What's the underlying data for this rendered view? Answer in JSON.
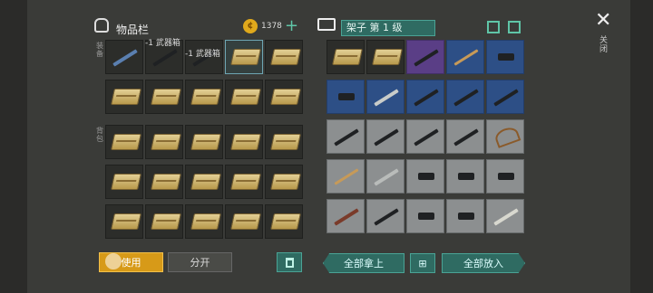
{
  "inventory": {
    "title": "物品栏",
    "coins": "1378",
    "side_top_label": "装备",
    "side_mid_label": "背包",
    "weapon_box_label_1": "-1 武器箱",
    "weapon_box_label_2": "-1 武器箱"
  },
  "shelf": {
    "title": "架子 第 1 级"
  },
  "close": {
    "label": "关闭"
  },
  "buttons": {
    "use": "使用",
    "split": "分开",
    "take_all": "全部拿上",
    "put_all": "全部放入"
  },
  "colors": {
    "accent": "#2f6b62",
    "use": "#d79a18",
    "rare_blue": "#2d4f86",
    "rare_purple": "#5a3e86"
  },
  "icons": [
    "backpack-icon",
    "coin-icon",
    "plus-icon",
    "book-stack-icon",
    "edit-icon",
    "upload-icon",
    "close-icon",
    "trash-icon",
    "grid-icon"
  ]
}
